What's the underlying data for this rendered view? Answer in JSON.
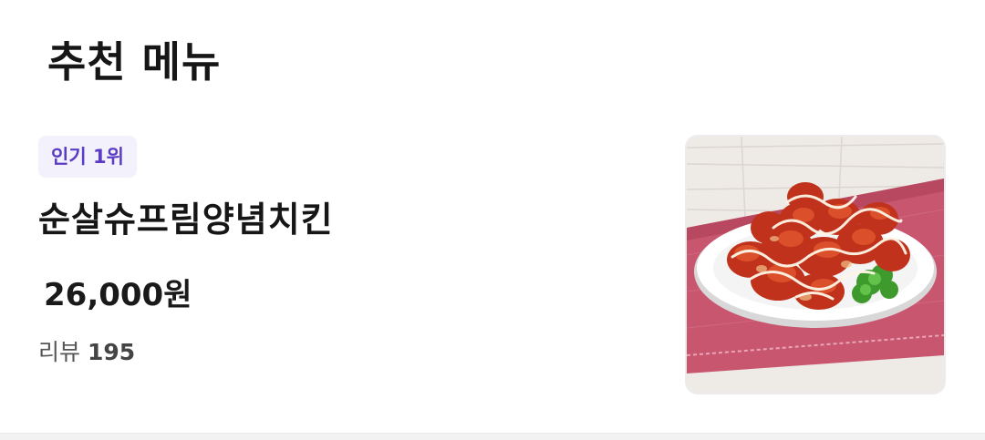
{
  "section": {
    "title": "추천 메뉴"
  },
  "menu": {
    "badge": "인기 1위",
    "name": "순살슈프림양념치킨",
    "price": "26,000원",
    "review_label": "리뷰",
    "review_count": "195",
    "image_icon": "food-photo-icon"
  },
  "colors": {
    "badge_bg": "#f3f1fc",
    "badge_text": "#5b3cc4",
    "text_primary": "#161616",
    "text_secondary": "#555555"
  }
}
